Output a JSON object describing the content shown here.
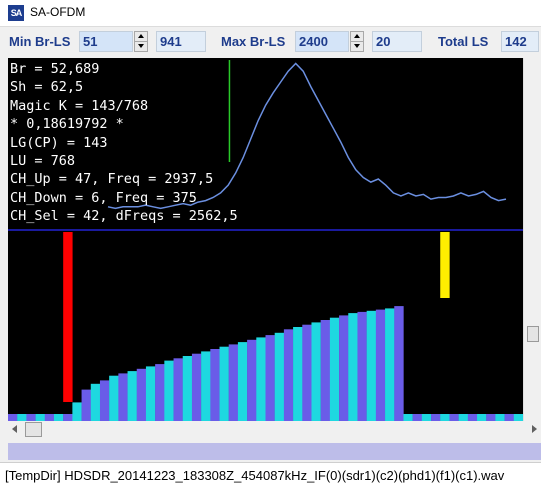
{
  "window": {
    "title": "SA-OFDM",
    "icon": "SA"
  },
  "controls": {
    "min_label": "Min Br-LS",
    "min_value": "51",
    "min_readout": "941",
    "max_label": "Max Br-LS",
    "max_value": "2400",
    "max_readout": "20",
    "total_label": "Total LS",
    "total_value": "142"
  },
  "info_lines": [
    "Br = 52,689",
    "Sh = 62,5",
    "Magic K = 143/768",
    "* 0,18619792 *",
    "LG(CP) = 143",
    "LU = 768",
    "CH_Up = 47, Freq = 2937,5",
    "CH_Down = 6, Freq = 375",
    "CH_Sel = 42, dFreqs = 2562,5"
  ],
  "colors": {
    "background": "#000000",
    "correlation_curve": "#6b8fe0",
    "cursor_line": "#29c929",
    "separator": "#1a1a9e",
    "bar_purple": "#6a5ce8",
    "bar_cyan": "#1ed8e0",
    "marker_down": "#ff0000",
    "marker_up": "#ffee00"
  },
  "chart_data": {
    "type": "bar",
    "series": [
      {
        "values": [
          10,
          21,
          26,
          29,
          33,
          35,
          37,
          39,
          41,
          43,
          46,
          48,
          50,
          52,
          54,
          56,
          58,
          60,
          62,
          64,
          66,
          68,
          70,
          73,
          75,
          77,
          79,
          81,
          83,
          85,
          87,
          88,
          89,
          90,
          91,
          93
        ]
      }
    ],
    "markers": [
      {
        "channel": 6,
        "color": "#ff0000"
      },
      {
        "channel": 47,
        "color": "#ffee00"
      }
    ],
    "correlation_curve": [
      6,
      5,
      6,
      6,
      6,
      7,
      6,
      5,
      6,
      7,
      8,
      7,
      9,
      10,
      12,
      15,
      20,
      28,
      38,
      50,
      62,
      72,
      80,
      87,
      94,
      99,
      94,
      84,
      75,
      66,
      57,
      48,
      38,
      30,
      25,
      22,
      24,
      20,
      15,
      13,
      15,
      13,
      14,
      11,
      12,
      12,
      13,
      15,
      13,
      14,
      16,
      12,
      10,
      11
    ],
    "cursor_position": 0.43,
    "ylim": [
      0,
      100
    ]
  },
  "scroll": {
    "vertical_position": 0.76,
    "horizontal_position": 0.0
  },
  "status": {
    "text": "[TempDir] HDSDR_20141223_183308Z_454087kHz_IF(0)(sdr1)(c2)(phd1)(f1)(c1).wav"
  }
}
